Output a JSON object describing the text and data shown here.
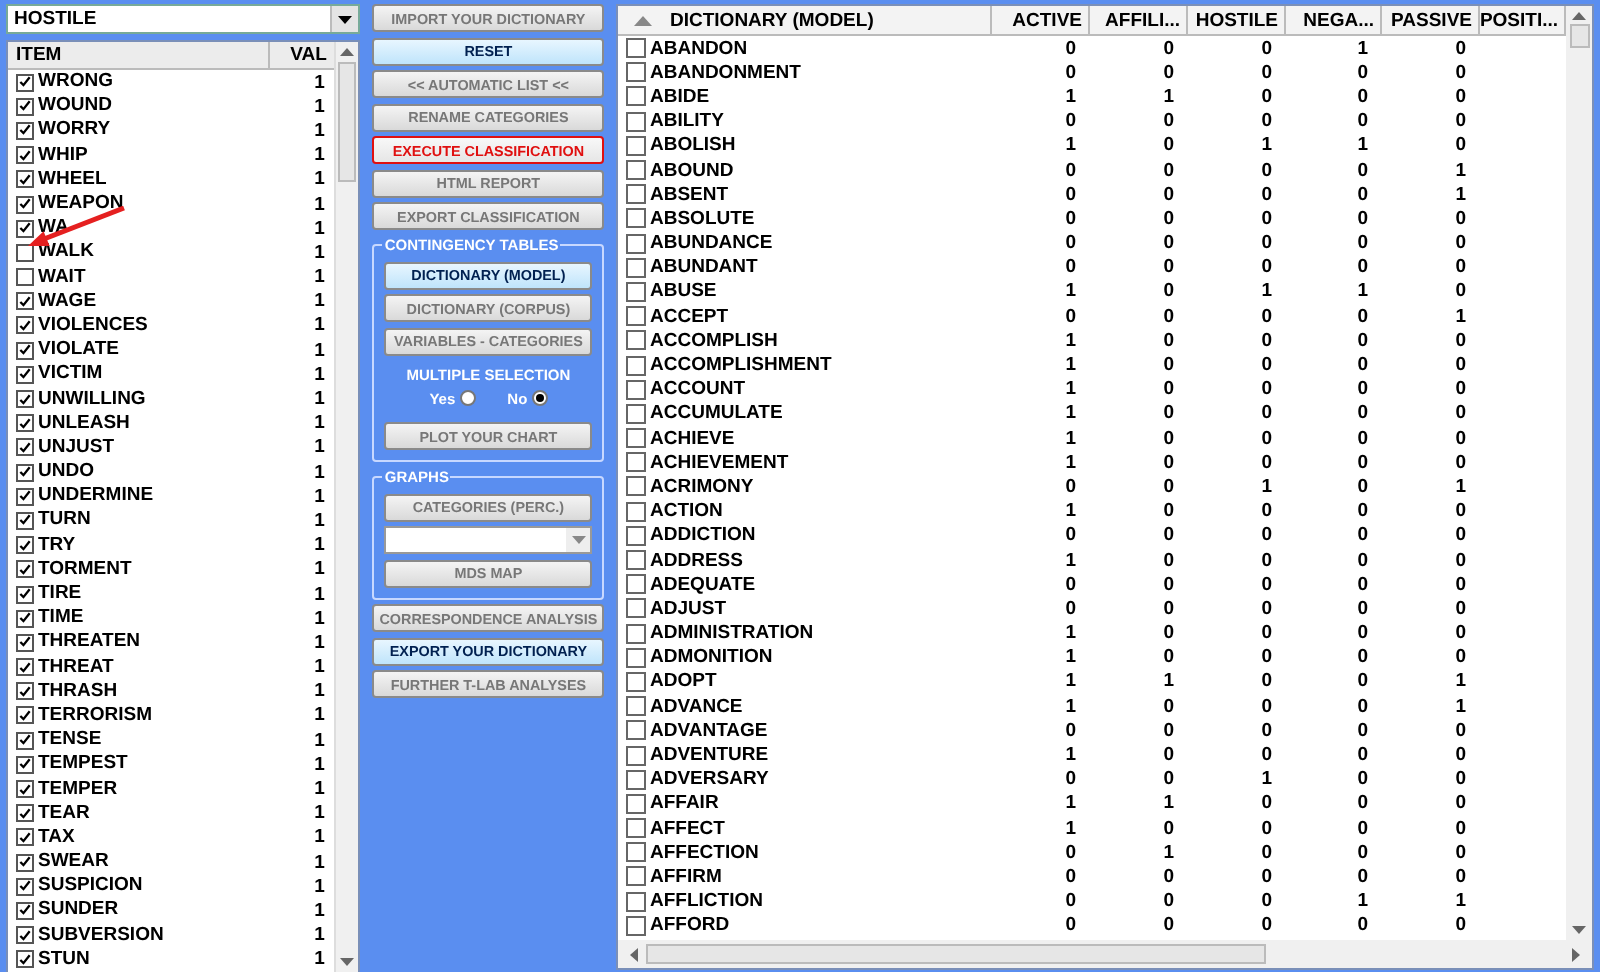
{
  "category_select": {
    "value": "HOSTILE"
  },
  "item_list": {
    "columns": [
      "ITEM",
      "VAL"
    ],
    "rows": [
      {
        "item": "WRONG",
        "val": "1",
        "checked": true
      },
      {
        "item": "WOUND",
        "val": "1",
        "checked": true
      },
      {
        "item": "WORRY",
        "val": "1",
        "checked": true
      },
      {
        "item": "WHIP",
        "val": "1",
        "checked": true
      },
      {
        "item": "WHEEL",
        "val": "1",
        "checked": true
      },
      {
        "item": "WEAPON",
        "val": "1",
        "checked": true
      },
      {
        "item": "WA",
        "val": "1",
        "checked": true
      },
      {
        "item": "WALK",
        "val": "1",
        "checked": false
      },
      {
        "item": "WAIT",
        "val": "1",
        "checked": false
      },
      {
        "item": "WAGE",
        "val": "1",
        "checked": true
      },
      {
        "item": "VIOLENCES",
        "val": "1",
        "checked": true
      },
      {
        "item": "VIOLATE",
        "val": "1",
        "checked": true
      },
      {
        "item": "VICTIM",
        "val": "1",
        "checked": true
      },
      {
        "item": "UNWILLING",
        "val": "1",
        "checked": true
      },
      {
        "item": "UNLEASH",
        "val": "1",
        "checked": true
      },
      {
        "item": "UNJUST",
        "val": "1",
        "checked": true
      },
      {
        "item": "UNDO",
        "val": "1",
        "checked": true
      },
      {
        "item": "UNDERMINE",
        "val": "1",
        "checked": true
      },
      {
        "item": "TURN",
        "val": "1",
        "checked": true
      },
      {
        "item": "TRY",
        "val": "1",
        "checked": true
      },
      {
        "item": "TORMENT",
        "val": "1",
        "checked": true
      },
      {
        "item": "TIRE",
        "val": "1",
        "checked": true
      },
      {
        "item": "TIME",
        "val": "1",
        "checked": true
      },
      {
        "item": "THREATEN",
        "val": "1",
        "checked": true
      },
      {
        "item": "THREAT",
        "val": "1",
        "checked": true
      },
      {
        "item": "THRASH",
        "val": "1",
        "checked": true
      },
      {
        "item": "TERRORISM",
        "val": "1",
        "checked": true
      },
      {
        "item": "TENSE",
        "val": "1",
        "checked": true
      },
      {
        "item": "TEMPEST",
        "val": "1",
        "checked": true
      },
      {
        "item": "TEMPER",
        "val": "1",
        "checked": true
      },
      {
        "item": "TEAR",
        "val": "1",
        "checked": true
      },
      {
        "item": "TAX",
        "val": "1",
        "checked": true
      },
      {
        "item": "SWEAR",
        "val": "1",
        "checked": true
      },
      {
        "item": "SUSPICION",
        "val": "1",
        "checked": true
      },
      {
        "item": "SUNDER",
        "val": "1",
        "checked": true
      },
      {
        "item": "SUBVERSION",
        "val": "1",
        "checked": true
      },
      {
        "item": "STUN",
        "val": "1",
        "checked": true
      }
    ]
  },
  "top_buttons": [
    {
      "label": "IMPORT YOUR DICTIONARY",
      "kind": "default"
    },
    {
      "label": "RESET",
      "kind": "highlight"
    },
    {
      "label": "<< AUTOMATIC LIST <<",
      "kind": "default"
    },
    {
      "label": "RENAME CATEGORIES",
      "kind": "default"
    },
    {
      "label": "EXECUTE CLASSIFICATION",
      "kind": "alert"
    },
    {
      "label": "HTML REPORT",
      "kind": "default"
    },
    {
      "label": "EXPORT CLASSIFICATION",
      "kind": "default"
    }
  ],
  "contingency_tables": {
    "title": "CONTINGENCY TABLES",
    "buttons": [
      {
        "label": "DICTIONARY (MODEL)",
        "kind": "highlight"
      },
      {
        "label": "DICTIONARY (CORPUS)",
        "kind": "default"
      },
      {
        "label": "VARIABLES - CATEGORIES",
        "kind": "default"
      }
    ],
    "multiple_selection": {
      "title": "MULTIPLE SELECTION",
      "options": [
        {
          "label": "Yes",
          "selected": false
        },
        {
          "label": "No",
          "selected": true
        }
      ]
    },
    "plot_button": {
      "label": "PLOT YOUR CHART"
    }
  },
  "graphs": {
    "title": "GRAPHS",
    "categories_button": {
      "label": "CATEGORIES  (PERC.)"
    },
    "mds_button": {
      "label": "MDS MAP"
    }
  },
  "bottom_buttons": [
    {
      "label": "CORRESPONDENCE ANALYSIS",
      "kind": "default"
    },
    {
      "label": "EXPORT YOUR DICTIONARY",
      "kind": "highlight"
    },
    {
      "label": "FURTHER T-LAB ANALYSES",
      "kind": "default"
    }
  ],
  "dictionary_table": {
    "columns": [
      "DICTIONARY (MODEL)",
      "ACTIVE",
      "AFFILI...",
      "HOSTILE",
      "NEGA...",
      "PASSIVE",
      "POSITI..."
    ],
    "rows": [
      {
        "word": "ABANDON",
        "values": [
          "0",
          "0",
          "0",
          "1",
          "0"
        ],
        "checked": false
      },
      {
        "word": "ABANDONMENT",
        "values": [
          "0",
          "0",
          "0",
          "0",
          "0"
        ],
        "checked": false
      },
      {
        "word": "ABIDE",
        "values": [
          "1",
          "1",
          "0",
          "0",
          "0"
        ],
        "checked": false
      },
      {
        "word": "ABILITY",
        "values": [
          "0",
          "0",
          "0",
          "0",
          "0"
        ],
        "checked": false
      },
      {
        "word": "ABOLISH",
        "values": [
          "1",
          "0",
          "1",
          "1",
          "0"
        ],
        "checked": false
      },
      {
        "word": "ABOUND",
        "values": [
          "0",
          "0",
          "0",
          "0",
          "1"
        ],
        "checked": false
      },
      {
        "word": "ABSENT",
        "values": [
          "0",
          "0",
          "0",
          "0",
          "1"
        ],
        "checked": false
      },
      {
        "word": "ABSOLUTE",
        "values": [
          "0",
          "0",
          "0",
          "0",
          "0"
        ],
        "checked": false
      },
      {
        "word": "ABUNDANCE",
        "values": [
          "0",
          "0",
          "0",
          "0",
          "0"
        ],
        "checked": false
      },
      {
        "word": "ABUNDANT",
        "values": [
          "0",
          "0",
          "0",
          "0",
          "0"
        ],
        "checked": false
      },
      {
        "word": "ABUSE",
        "values": [
          "1",
          "0",
          "1",
          "1",
          "0"
        ],
        "checked": false
      },
      {
        "word": "ACCEPT",
        "values": [
          "0",
          "0",
          "0",
          "0",
          "1"
        ],
        "checked": false
      },
      {
        "word": "ACCOMPLISH",
        "values": [
          "1",
          "0",
          "0",
          "0",
          "0"
        ],
        "checked": false
      },
      {
        "word": "ACCOMPLISHMENT",
        "values": [
          "1",
          "0",
          "0",
          "0",
          "0"
        ],
        "checked": false
      },
      {
        "word": "ACCOUNT",
        "values": [
          "1",
          "0",
          "0",
          "0",
          "0"
        ],
        "checked": false
      },
      {
        "word": "ACCUMULATE",
        "values": [
          "1",
          "0",
          "0",
          "0",
          "0"
        ],
        "checked": false
      },
      {
        "word": "ACHIEVE",
        "values": [
          "1",
          "0",
          "0",
          "0",
          "0"
        ],
        "checked": false
      },
      {
        "word": "ACHIEVEMENT",
        "values": [
          "1",
          "0",
          "0",
          "0",
          "0"
        ],
        "checked": false
      },
      {
        "word": "ACRIMONY",
        "values": [
          "0",
          "0",
          "1",
          "0",
          "1"
        ],
        "checked": false
      },
      {
        "word": "ACTION",
        "values": [
          "1",
          "0",
          "0",
          "0",
          "0"
        ],
        "checked": false
      },
      {
        "word": "ADDICTION",
        "values": [
          "0",
          "0",
          "0",
          "0",
          "0"
        ],
        "checked": false
      },
      {
        "word": "ADDRESS",
        "values": [
          "1",
          "0",
          "0",
          "0",
          "0"
        ],
        "checked": false
      },
      {
        "word": "ADEQUATE",
        "values": [
          "0",
          "0",
          "0",
          "0",
          "0"
        ],
        "checked": false
      },
      {
        "word": "ADJUST",
        "values": [
          "0",
          "0",
          "0",
          "0",
          "0"
        ],
        "checked": false
      },
      {
        "word": "ADMINISTRATION",
        "values": [
          "1",
          "0",
          "0",
          "0",
          "0"
        ],
        "checked": false
      },
      {
        "word": "ADMONITION",
        "values": [
          "1",
          "0",
          "0",
          "0",
          "0"
        ],
        "checked": false
      },
      {
        "word": "ADOPT",
        "values": [
          "1",
          "1",
          "0",
          "0",
          "1"
        ],
        "checked": false
      },
      {
        "word": "ADVANCE",
        "values": [
          "1",
          "0",
          "0",
          "0",
          "1"
        ],
        "checked": false
      },
      {
        "word": "ADVANTAGE",
        "values": [
          "0",
          "0",
          "0",
          "0",
          "0"
        ],
        "checked": false
      },
      {
        "word": "ADVENTURE",
        "values": [
          "1",
          "0",
          "0",
          "0",
          "0"
        ],
        "checked": false
      },
      {
        "word": "ADVERSARY",
        "values": [
          "0",
          "0",
          "1",
          "0",
          "0"
        ],
        "checked": false
      },
      {
        "word": "AFFAIR",
        "values": [
          "1",
          "1",
          "0",
          "0",
          "0"
        ],
        "checked": false
      },
      {
        "word": "AFFECT",
        "values": [
          "1",
          "0",
          "0",
          "0",
          "0"
        ],
        "checked": false
      },
      {
        "word": "AFFECTION",
        "values": [
          "0",
          "1",
          "0",
          "0",
          "0"
        ],
        "checked": false
      },
      {
        "word": "AFFIRM",
        "values": [
          "0",
          "0",
          "0",
          "0",
          "0"
        ],
        "checked": false
      },
      {
        "word": "AFFLICTION",
        "values": [
          "0",
          "0",
          "0",
          "1",
          "1"
        ],
        "checked": false
      },
      {
        "word": "AFFORD",
        "values": [
          "0",
          "0",
          "0",
          "0",
          "0"
        ],
        "checked": false
      }
    ]
  }
}
